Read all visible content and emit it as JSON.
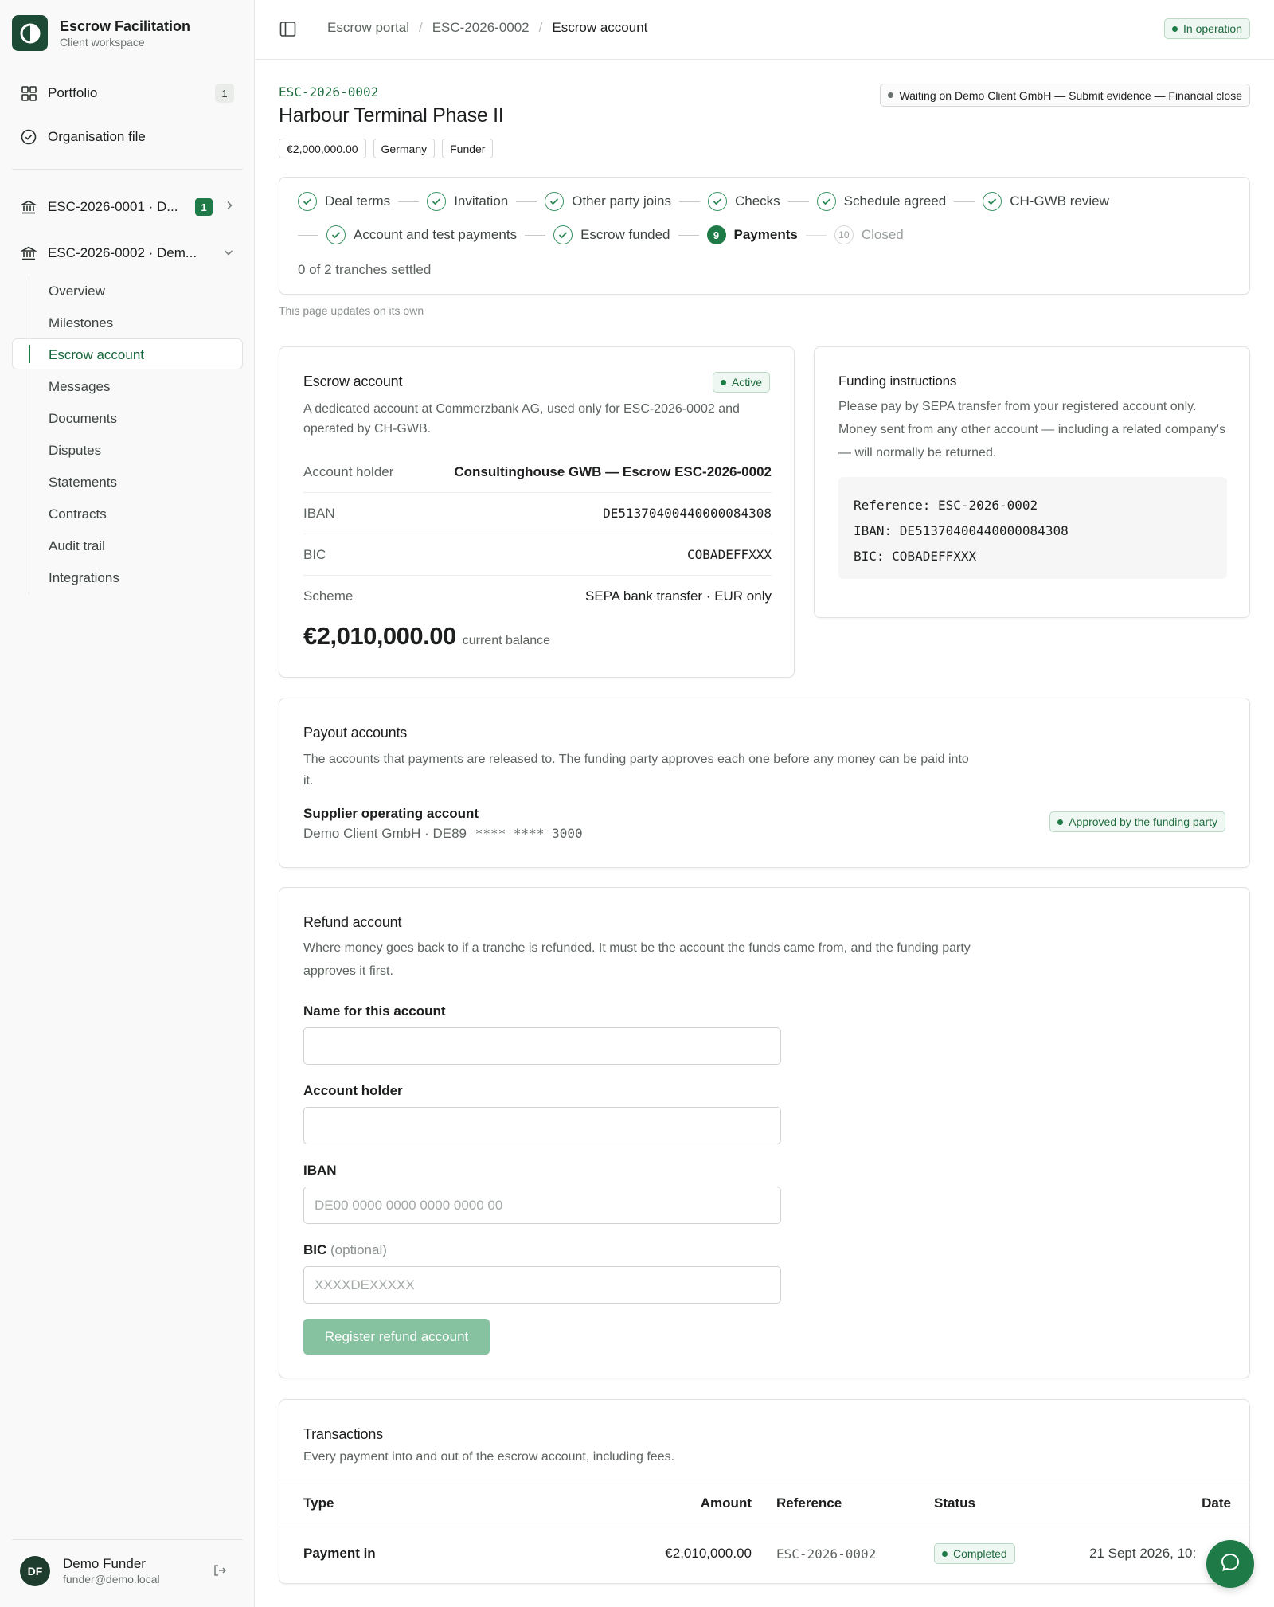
{
  "brand": {
    "title": "Escrow Facilitation",
    "subtitle": "Client workspace"
  },
  "sidebar": {
    "portfolio": {
      "label": "Portfolio",
      "count": "1"
    },
    "organisation": {
      "label": "Organisation file"
    },
    "escrows": [
      {
        "label": "ESC-2026-0001 · D...",
        "badge": "1"
      },
      {
        "label": "ESC-2026-0002 · Dem..."
      }
    ],
    "subitems": [
      {
        "label": "Overview"
      },
      {
        "label": "Milestones"
      },
      {
        "label": "Escrow account"
      },
      {
        "label": "Messages"
      },
      {
        "label": "Documents"
      },
      {
        "label": "Disputes"
      },
      {
        "label": "Statements"
      },
      {
        "label": "Contracts"
      },
      {
        "label": "Audit trail"
      },
      {
        "label": "Integrations"
      }
    ],
    "user": {
      "initials": "DF",
      "name": "Demo Funder",
      "email": "funder@demo.local"
    }
  },
  "topbar": {
    "breadcrumbs": [
      "Escrow portal",
      "ESC-2026-0002",
      "Escrow account"
    ],
    "status": "In operation"
  },
  "header": {
    "id": "ESC-2026-0002",
    "title": "Harbour Terminal Phase II",
    "tags": [
      "€2,000,000.00",
      "Germany",
      "Funder"
    ],
    "waiting": "Waiting on Demo Client GmbH — Submit evidence — Financial close"
  },
  "stepper": {
    "row1": [
      "Deal terms",
      "Invitation",
      "Other party joins",
      "Checks",
      "Schedule agreed",
      "CH-GWB review"
    ],
    "row2_done": [
      "Account and test payments",
      "Escrow funded"
    ],
    "current": {
      "num": "9",
      "label": "Payments"
    },
    "future": {
      "num": "10",
      "label": "Closed"
    },
    "tranches": "0 of 2 tranches settled",
    "updates_note": "This page updates on its own"
  },
  "escrow_account": {
    "title": "Escrow account",
    "status": "Active",
    "description": "A dedicated account at Commerzbank AG, used only for ESC-2026-0002 and operated by CH-GWB.",
    "rows": [
      {
        "k": "Account holder",
        "v": "Consultinghouse GWB — Escrow ESC-2026-0002"
      },
      {
        "k": "IBAN",
        "v": "DE51370400440000084308"
      },
      {
        "k": "BIC",
        "v": "COBADEFFXXX"
      },
      {
        "k": "Scheme",
        "v": "SEPA bank transfer · EUR only"
      }
    ],
    "balance": "€2,010,000.00",
    "balance_label": "current balance"
  },
  "funding": {
    "title": "Funding instructions",
    "description": "Please pay by SEPA transfer from your registered account only. Money sent from any other account — including a related company's — will normally be returned.",
    "lines": [
      "Reference: ESC-2026-0002",
      "IBAN: DE51370400440000084308",
      "BIC: COBADEFFXXX"
    ]
  },
  "payout": {
    "title": "Payout accounts",
    "description": "The accounts that payments are released to. The funding party approves each one before any money can be paid into it.",
    "account_name": "Supplier operating account",
    "account_owner": "Demo Client GmbH · DE89",
    "account_masked": "**** **** 3000",
    "status": "Approved by the funding party"
  },
  "refund": {
    "title": "Refund account",
    "description": "Where money goes back to if a tranche is refunded. It must be the account the funds came from, and the funding party approves it first.",
    "fields": {
      "name": {
        "label": "Name for this account",
        "value": "",
        "placeholder": ""
      },
      "holder": {
        "label": "Account holder",
        "value": "",
        "placeholder": ""
      },
      "iban": {
        "label": "IBAN",
        "value": "",
        "placeholder": "DE00 0000 0000 0000 0000 00"
      },
      "bic": {
        "label": "BIC",
        "optional": "(optional)",
        "value": "",
        "placeholder": "XXXXDEXXXXX"
      }
    },
    "submit": "Register refund account"
  },
  "transactions": {
    "title": "Transactions",
    "description": "Every payment into and out of the escrow account, including fees.",
    "columns": [
      "Type",
      "Amount",
      "Reference",
      "Status",
      "Date"
    ],
    "rows": [
      {
        "type": "Payment in",
        "amount": "€2,010,000.00",
        "reference": "ESC-2026-0002",
        "status": "Completed",
        "date": "21 Sept 2026, 10:"
      }
    ]
  },
  "colors": {
    "accent": "#1e7a46",
    "brand_dark": "#1d4a34",
    "button_disabled": "#86c29f"
  },
  "icons": [
    "brand-logo-icon",
    "grid-icon",
    "check-circle-icon",
    "bank-icon",
    "chevron-right-icon",
    "chevron-down-icon",
    "sidebar-toggle-icon",
    "check-icon",
    "logout-icon",
    "chat-icon"
  ]
}
